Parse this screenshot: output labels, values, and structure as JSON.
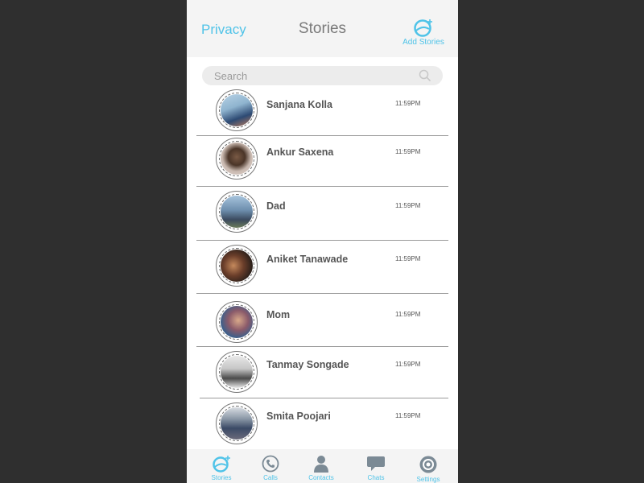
{
  "header": {
    "privacy_label": "Privacy",
    "title": "Stories",
    "add_stories_label": "Add Stories"
  },
  "search": {
    "placeholder": "Search"
  },
  "stories": [
    {
      "name": "Sanjana Kolla",
      "time": "11:59PM"
    },
    {
      "name": "Ankur Saxena",
      "time": "11:59PM"
    },
    {
      "name": "Dad",
      "time": "11:59PM"
    },
    {
      "name": "Aniket Tanawade",
      "time": "11:59PM"
    },
    {
      "name": "Mom",
      "time": "11:59PM"
    },
    {
      "name": "Tanmay Songade",
      "time": "11:59PM"
    },
    {
      "name": "Smita Poojari",
      "time": "11:59PM"
    }
  ],
  "tabs": [
    {
      "label": "Stories",
      "icon": "stories-icon"
    },
    {
      "label": "Calls",
      "icon": "phone-icon"
    },
    {
      "label": "Contacts",
      "icon": "contact-person-icon"
    },
    {
      "label": "Chats",
      "icon": "chat-bubble-icon"
    },
    {
      "label": "Settings",
      "icon": "settings-gear-icon"
    }
  ],
  "colors": {
    "accent": "#4fc3e8",
    "icon_gray": "#7b8a95",
    "background": "#2f2f2f",
    "header_bg": "#f4f4f4"
  }
}
